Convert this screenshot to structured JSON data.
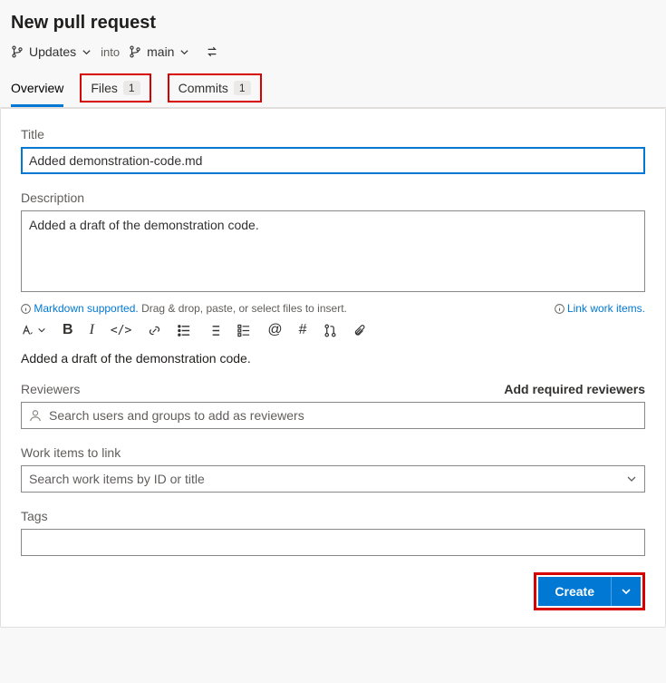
{
  "header": {
    "title": "New pull request",
    "source_branch": "Updates",
    "into_label": "into",
    "target_branch": "main"
  },
  "tabs": {
    "overview": "Overview",
    "files": {
      "label": "Files",
      "count": "1"
    },
    "commits": {
      "label": "Commits",
      "count": "1"
    }
  },
  "form": {
    "title_label": "Title",
    "title_value": "Added demonstration-code.md",
    "description_label": "Description",
    "description_value": "Added a draft of the demonstration code.",
    "markdown_supported": "Markdown supported.",
    "drag_hint": "Drag & drop, paste, or select files to insert.",
    "link_work_items": "Link work items.",
    "preview_text": "Added a draft of the demonstration code.",
    "reviewers_label": "Reviewers",
    "add_required_reviewers": "Add required reviewers",
    "reviewers_placeholder": "Search users and groups to add as reviewers",
    "work_items_label": "Work items to link",
    "work_items_placeholder": "Search work items by ID or title",
    "tags_label": "Tags",
    "create_label": "Create"
  }
}
